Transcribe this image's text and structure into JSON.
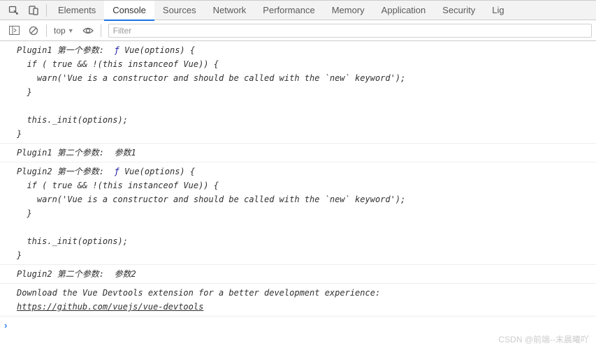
{
  "tabs": {
    "items": [
      "Elements",
      "Console",
      "Sources",
      "Network",
      "Performance",
      "Memory",
      "Application",
      "Security",
      "Lig"
    ],
    "active": "Console"
  },
  "toolbar": {
    "context": "top",
    "filter_placeholder": "Filter"
  },
  "console": {
    "entries": [
      {
        "prefix": "Plugin1 第一个参数:  ",
        "fn": "ƒ",
        "body": " Vue(options) {\n  if ( true && !(this instanceof Vue)) {\n    warn('Vue is a constructor and should be called with the `new` keyword');\n  }\n\n  this._init(options);\n}"
      },
      {
        "text": "Plugin1 第二个参数:  参数1"
      },
      {
        "prefix": "Plugin2 第一个参数:  ",
        "fn": "ƒ",
        "body": " Vue(options) {\n  if ( true && !(this instanceof Vue)) {\n    warn('Vue is a constructor and should be called with the `new` keyword');\n  }\n\n  this._init(options);\n}"
      },
      {
        "text": "Plugin2 第二个参数:  参数2"
      },
      {
        "text_pre": "Download the Vue Devtools extension for a better development experience:\n",
        "link": "https://github.com/vuejs/vue-devtools"
      }
    ]
  },
  "watermark": "CSDN @前端--末晨曦吖"
}
